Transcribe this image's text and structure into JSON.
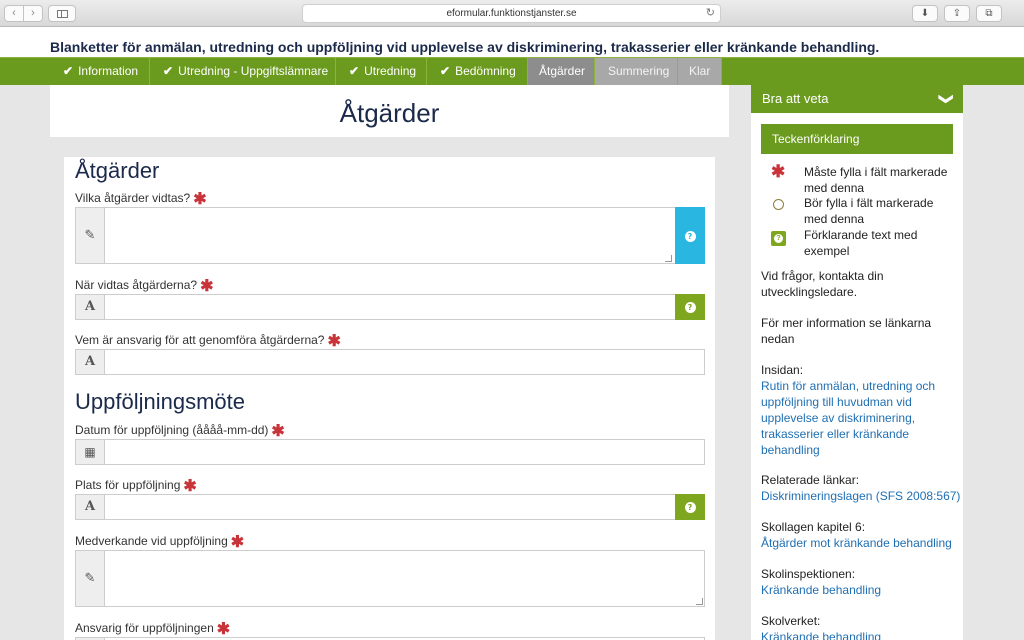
{
  "browser": {
    "url": "eformular.funktionstjanster.se",
    "back": "‹",
    "forward": "›",
    "reload": "↻",
    "download": "⬇",
    "share": "⇪",
    "tabs": "⧉"
  },
  "header": {
    "title": "Blanketter för anmälan, utredning och uppföljning vid upplevelse av diskriminering, trakasserier eller kränkande behandling."
  },
  "tabs": [
    {
      "label": "Information",
      "check": "✔"
    },
    {
      "label": "Utredning - Uppgiftslämnare",
      "check": "✔"
    },
    {
      "label": "Utredning",
      "check": "✔"
    },
    {
      "label": "Bedömning",
      "check": "✔"
    },
    {
      "label": "Åtgärder"
    },
    {
      "label": "Summering"
    },
    {
      "label": "Klar"
    }
  ],
  "main": {
    "heading": "Åtgärder",
    "section1_title": "Åtgärder",
    "section2_title": "Uppföljningsmöte",
    "required_mark": "✱",
    "help_mark": "?",
    "icons": {
      "pencil": "✎",
      "text": "A",
      "calendar": "▦"
    },
    "fields": [
      {
        "label": "Vilka åtgärder vidtas?",
        "value": ""
      },
      {
        "label": "När vidtas åtgärderna?",
        "value": ""
      },
      {
        "label": "Vem är ansvarig för att genomföra åtgärderna?",
        "value": ""
      },
      {
        "label": "Datum för uppföljning (åååå-mm-dd)",
        "value": ""
      },
      {
        "label": "Plats för uppföljning",
        "value": ""
      },
      {
        "label": "Medverkande vid uppföljning",
        "value": ""
      },
      {
        "label": "Ansvarig för uppföljningen",
        "value": ""
      }
    ]
  },
  "sidebar": {
    "title": "Bra att veta",
    "chevron": "❯",
    "legend_title": "Teckenförklaring",
    "legend": [
      {
        "symbol": "✱",
        "text": "Måste fylla i fält markerade med denna"
      },
      {
        "text": "Bör fylla i fält markerade med denna"
      },
      {
        "symbol": "?",
        "text": "Förklarande text med exempel"
      }
    ],
    "contact": "Vid frågor, kontakta din utvecklingsledare.",
    "more_info": "För mer information se länkarna nedan",
    "insidan_label": "Insidan:",
    "insidan_link": "Rutin för anmälan, utredning och uppföljning till huvudman vid upplevelse av diskriminering, trakasserier eller kränkande behandling",
    "related_label": "Relaterade länkar:",
    "related_link": "Diskrimineringslagen (SFS 2008:567)",
    "skollagen_label": "Skollagen kapitel 6:",
    "skollagen_link": "Åtgärder mot kränkande behandling",
    "skolinsp_label": "Skolinspektionen:",
    "skolinsp_link": "Kränkande behandling",
    "skolverket_label": "Skolverket:",
    "skolverket_link": "Kränkande behandling"
  },
  "colors": {
    "green": "#6b9b1e",
    "help_green": "#7ea61f",
    "help_blue": "#29b7e2",
    "required_red": "#c8343a",
    "link_blue": "#1f6fb3"
  }
}
